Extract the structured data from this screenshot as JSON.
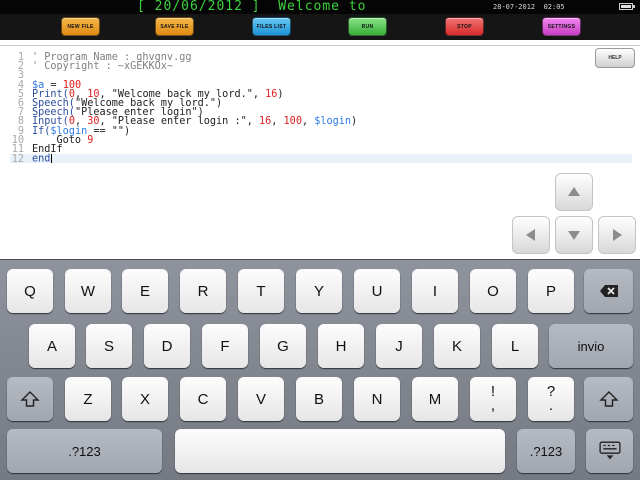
{
  "status_bar": {
    "marquee": "[ 20/06/2012 ]  Welcome to",
    "datetime": "28-07-2012  02:05",
    "battery_level": 0.85
  },
  "toolbar": {
    "new_file": "NEW FILE",
    "save_file": "SAVE FILE",
    "files_list": "FILES LIST",
    "run": "RUN",
    "stop": "STOP",
    "settings": "SETTINGS"
  },
  "editor": {
    "help": "HELP",
    "lines": [
      {
        "no": "1",
        "tokens": [
          {
            "t": "' Program Name : ghvgnv.gg",
            "c": "comment"
          }
        ]
      },
      {
        "no": "2",
        "tokens": [
          {
            "t": "' Copyright : ~xGEKKOx~",
            "c": "comment"
          }
        ]
      },
      {
        "no": "3",
        "tokens": []
      },
      {
        "no": "4",
        "tokens": [
          {
            "t": "$a",
            "c": "var"
          },
          {
            "t": " = ",
            "c": "plain"
          },
          {
            "t": "100",
            "c": "num"
          }
        ]
      },
      {
        "no": "5",
        "tokens": [
          {
            "t": "Print(",
            "c": "kw"
          },
          {
            "t": "0",
            "c": "num"
          },
          {
            "t": ", ",
            "c": "plain"
          },
          {
            "t": "10",
            "c": "num"
          },
          {
            "t": ", \"Welcome back my lord.\", ",
            "c": "str"
          },
          {
            "t": "16",
            "c": "num"
          },
          {
            "t": ")",
            "c": "plain"
          }
        ]
      },
      {
        "no": "6",
        "tokens": [
          {
            "t": "Speech(",
            "c": "kw"
          },
          {
            "t": "\"Welcome back my lord.\")",
            "c": "str"
          }
        ]
      },
      {
        "no": "7",
        "tokens": [
          {
            "t": "Speech(",
            "c": "kw"
          },
          {
            "t": "\"Please enter login\")",
            "c": "str"
          }
        ]
      },
      {
        "no": "8",
        "tokens": [
          {
            "t": "Input(",
            "c": "kw"
          },
          {
            "t": "0",
            "c": "num"
          },
          {
            "t": ", ",
            "c": "plain"
          },
          {
            "t": "30",
            "c": "num"
          },
          {
            "t": ", \"Please enter login :\", ",
            "c": "str"
          },
          {
            "t": "16",
            "c": "num"
          },
          {
            "t": ", ",
            "c": "plain"
          },
          {
            "t": "100",
            "c": "num"
          },
          {
            "t": ", ",
            "c": "plain"
          },
          {
            "t": "$login",
            "c": "var"
          },
          {
            "t": ")",
            "c": "plain"
          }
        ]
      },
      {
        "no": "9",
        "tokens": [
          {
            "t": "If(",
            "c": "kw"
          },
          {
            "t": "$login",
            "c": "var"
          },
          {
            "t": " == \"\")",
            "c": "plain"
          }
        ]
      },
      {
        "no": "10",
        "tokens": [
          {
            "t": "    Goto ",
            "c": "plain"
          },
          {
            "t": "9",
            "c": "num"
          }
        ]
      },
      {
        "no": "11",
        "tokens": [
          {
            "t": "EndIf",
            "c": "plain"
          }
        ]
      },
      {
        "no": "12",
        "tokens": [
          {
            "t": "end",
            "c": "kw"
          }
        ],
        "current": true
      }
    ]
  },
  "keyboard": {
    "row1": [
      "Q",
      "W",
      "E",
      "R",
      "T",
      "Y",
      "U",
      "I",
      "O",
      "P"
    ],
    "row2": [
      "A",
      "S",
      "D",
      "F",
      "G",
      "H",
      "J",
      "K",
      "L"
    ],
    "return_label": "invio",
    "row3": [
      "Z",
      "X",
      "C",
      "V",
      "B",
      "N",
      "M"
    ],
    "exclaim_top": "!",
    "exclaim_bottom": ",",
    "question_top": "?",
    "question_bottom": ".",
    "numbers_label": ".?123",
    "numbers_label_right": ".?123"
  },
  "icons": {
    "backspace": "backspace-icon",
    "shift": "shift-icon",
    "hide_keyboard": "keyboard-hide-icon",
    "arrows": [
      "arrow-up-icon",
      "arrow-left-icon",
      "arrow-down-icon",
      "arrow-right-icon"
    ]
  }
}
